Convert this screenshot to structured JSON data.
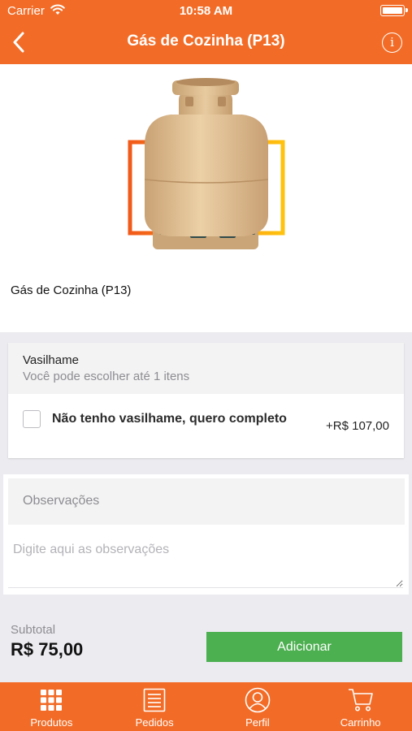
{
  "status_bar": {
    "carrier": "Carrier",
    "time": "10:58 AM"
  },
  "header": {
    "title": "Gás de Cozinha (P13)",
    "back_icon": "chevron-left-icon",
    "info_icon": "info-icon"
  },
  "product": {
    "name": "Gás de Cozinha (P13)",
    "image": "gas-cylinder-image"
  },
  "option_group": {
    "title": "Vasilhame",
    "subtitle": "Você pode escolher até 1 itens",
    "options": [
      {
        "label": "Não tenho vasilhame, quero completo",
        "price": "+R$ 107,00",
        "checked": false
      }
    ]
  },
  "notes": {
    "title": "Observações",
    "placeholder": "Digite aqui as observações",
    "value": ""
  },
  "footer": {
    "subtotal_label": "Subtotal",
    "subtotal_value": "R$ 75,00",
    "add_label": "Adicionar"
  },
  "tabs": [
    {
      "label": "Produtos",
      "icon": "grid-icon"
    },
    {
      "label": "Pedidos",
      "icon": "list-icon"
    },
    {
      "label": "Perfil",
      "icon": "user-icon"
    },
    {
      "label": "Carrinho",
      "icon": "cart-icon"
    }
  ],
  "colors": {
    "primary": "#f26c27",
    "add_button": "#4caf50",
    "background": "#ebebf0"
  }
}
